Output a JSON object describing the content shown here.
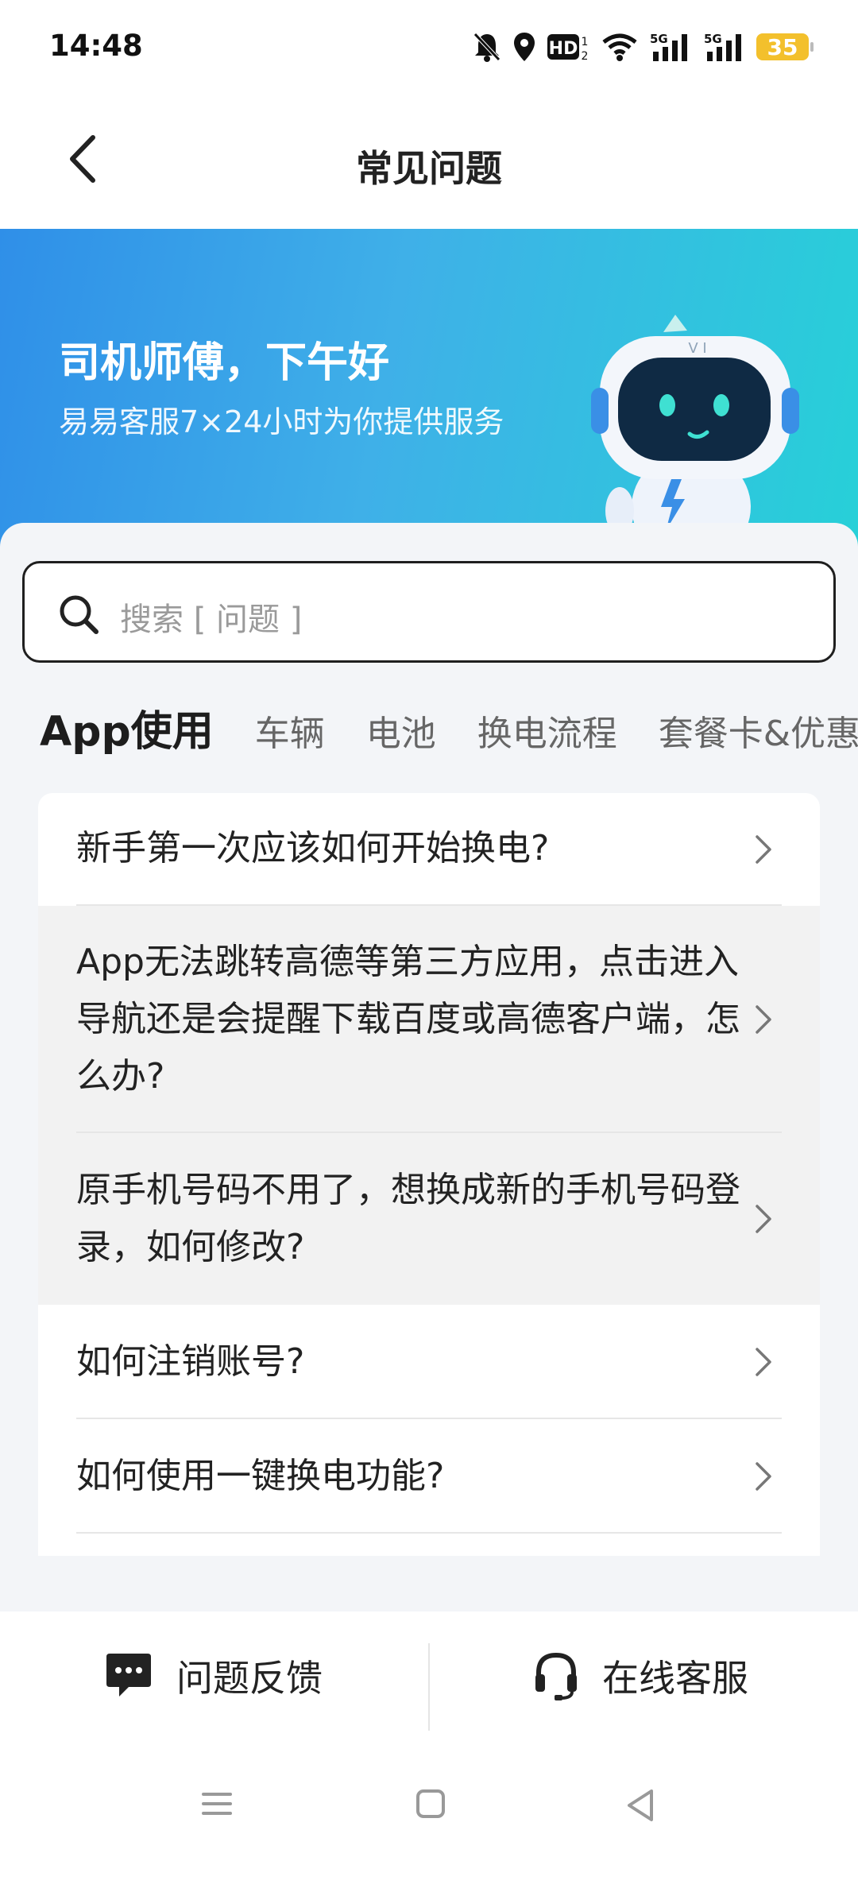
{
  "status_bar": {
    "time": "14:48",
    "icons": [
      "mute-bell-icon",
      "location-icon",
      "hd-icon",
      "wifi-icon",
      "5g-signal-icon",
      "5g-signal-icon"
    ],
    "battery": "35",
    "battery_color": "#f3c02c"
  },
  "nav": {
    "title": "常见问题",
    "back_icon": "chevron-left-icon"
  },
  "banner": {
    "greeting": "司机师傅，下午好",
    "subtitle": "易易客服7×24小时为你提供服务",
    "gradient_colors": [
      "#2f8fe8",
      "#27d0d8"
    ]
  },
  "search": {
    "placeholder": "搜索 [ 问题 ]"
  },
  "tabs": [
    {
      "label": "App使用",
      "active": true
    },
    {
      "label": "车辆",
      "active": false
    },
    {
      "label": "电池",
      "active": false
    },
    {
      "label": "换电流程",
      "active": false
    },
    {
      "label": "套餐卡&优惠",
      "active": false
    }
  ],
  "faq": [
    {
      "text": "新手第一次应该如何开始换电?"
    },
    {
      "text": "App无法跳转高德等第三方应用，点击进入导航还是会提醒下载百度或高德客户端，怎么办?"
    },
    {
      "text": "原手机号码不用了，想换成新的手机号码登录，如何修改?"
    },
    {
      "text": "如何注销账号?"
    },
    {
      "text": "如何使用一键换电功能?"
    }
  ],
  "bottom": {
    "feedback_label": "问题反馈",
    "service_label": "在线客服"
  },
  "system_nav": [
    "menu-icon",
    "home-icon",
    "back-triangle-icon"
  ]
}
